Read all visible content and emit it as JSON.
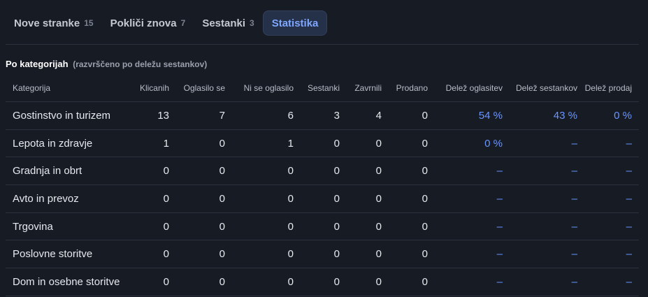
{
  "tabs": [
    {
      "label": "Nove stranke",
      "count": "15",
      "active": false
    },
    {
      "label": "Pokliči znova",
      "count": "7",
      "active": false
    },
    {
      "label": "Sestanki",
      "count": "3",
      "active": false
    },
    {
      "label": "Statistika",
      "count": "",
      "active": true
    }
  ],
  "section": {
    "title": "Po kategorijah",
    "subtitle": "(razvrščeno po deležu sestankov)"
  },
  "table": {
    "headers": [
      "Kategorija",
      "Klicanih",
      "Oglasilo se",
      "Ni se oglasilo",
      "Sestanki",
      "Zavrnili",
      "Prodano",
      "Delež oglasitev",
      "Delež sestankov",
      "Delež prodaj"
    ],
    "rows": [
      [
        "Gostinstvo in turizem",
        "13",
        "7",
        "6",
        "3",
        "4",
        "0",
        "54 %",
        "43 %",
        "0 %"
      ],
      [
        "Lepota in zdravje",
        "1",
        "0",
        "1",
        "0",
        "0",
        "0",
        "0 %",
        "–",
        "–"
      ],
      [
        "Gradnja in obrt",
        "0",
        "0",
        "0",
        "0",
        "0",
        "0",
        "–",
        "–",
        "–"
      ],
      [
        "Avto in prevoz",
        "0",
        "0",
        "0",
        "0",
        "0",
        "0",
        "–",
        "–",
        "–"
      ],
      [
        "Trgovina",
        "0",
        "0",
        "0",
        "0",
        "0",
        "0",
        "–",
        "–",
        "–"
      ],
      [
        "Poslovne storitve",
        "0",
        "0",
        "0",
        "0",
        "0",
        "0",
        "–",
        "–",
        "–"
      ],
      [
        "Dom in osebne storitve",
        "0",
        "0",
        "0",
        "0",
        "0",
        "0",
        "–",
        "–",
        "–"
      ]
    ]
  },
  "colors": {
    "background": "#161b24",
    "accent": "#7ea7ff",
    "percent": "#6b95ff"
  }
}
